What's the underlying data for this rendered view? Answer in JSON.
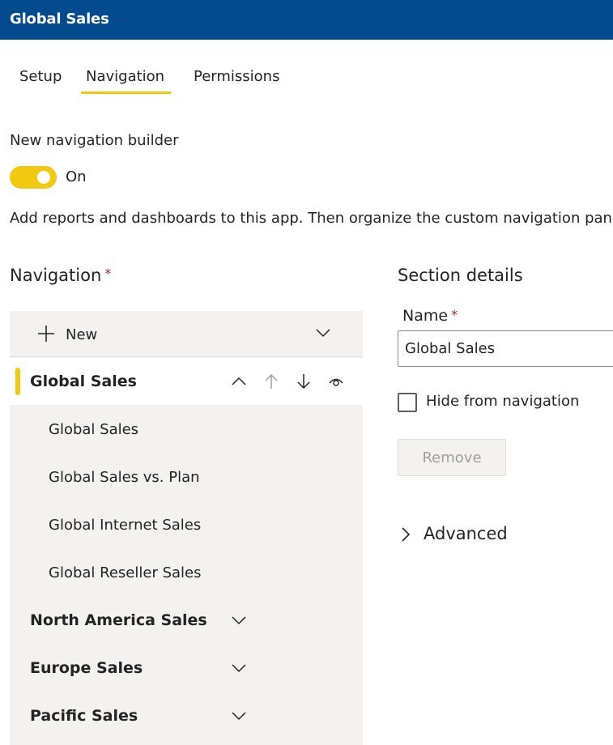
{
  "app": {
    "title": "Global Sales"
  },
  "tabs": [
    {
      "label": "Setup",
      "active": false
    },
    {
      "label": "Navigation",
      "active": true
    },
    {
      "label": "Permissions",
      "active": false
    }
  ],
  "builder": {
    "label": "New navigation builder",
    "toggle_state": "On",
    "description": "Add reports and dashboards to this app. Then organize the custom navigation pane"
  },
  "navigation": {
    "heading": "Navigation",
    "required_marker": "*",
    "new_label": "New",
    "selected_section": {
      "title": "Global Sales",
      "items": [
        "Global Sales",
        "Global Sales vs. Plan",
        "Global Internet Sales",
        "Global Reseller Sales"
      ]
    },
    "other_sections": [
      "North America Sales",
      "Europe Sales",
      "Pacific Sales"
    ]
  },
  "details": {
    "heading": "Section details",
    "name_label": "Name",
    "required_marker": "*",
    "name_value": "Global Sales",
    "hide_label": "Hide from navigation",
    "remove_label": "Remove",
    "advanced_label": "Advanced"
  },
  "colors": {
    "titlebar": "#034a8f",
    "accent": "#f2c811",
    "panel": "#f3f2f1",
    "required": "#a4262c"
  }
}
